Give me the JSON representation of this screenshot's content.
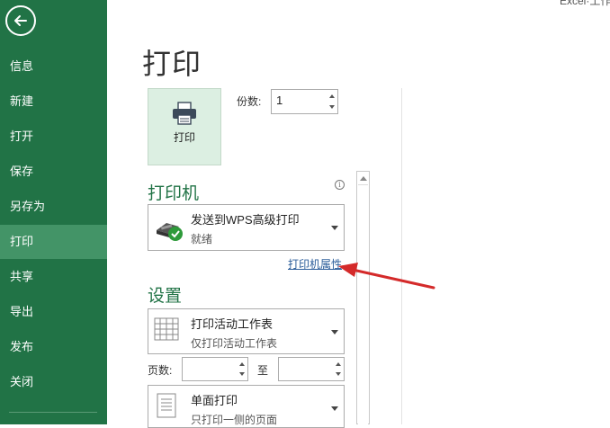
{
  "window": {
    "title": "Excel·工作簿"
  },
  "sidebar": {
    "items": [
      {
        "label": "信息"
      },
      {
        "label": "新建"
      },
      {
        "label": "打开"
      },
      {
        "label": "保存"
      },
      {
        "label": "另存为"
      },
      {
        "label": "打印"
      },
      {
        "label": "共享"
      },
      {
        "label": "导出"
      },
      {
        "label": "发布"
      },
      {
        "label": "关闭"
      }
    ],
    "active": "打印"
  },
  "page": {
    "title": "打印"
  },
  "print_button": {
    "label": "打印"
  },
  "copies": {
    "label": "份数:",
    "value": "1"
  },
  "printer": {
    "heading": "打印机",
    "name": "发送到WPS高级打印",
    "status": "就绪",
    "properties_link": "打印机属性"
  },
  "settings": {
    "heading": "设置",
    "scope": {
      "title": "打印活动工作表",
      "subtitle": "仅打印活动工作表"
    },
    "pages_label": "页数:",
    "to_label": "至",
    "pages_from": "",
    "pages_to": "",
    "sides": {
      "title": "单面打印",
      "subtitle": "只打印一侧的页面"
    }
  },
  "colors": {
    "accent": "#217346",
    "active_nav": "#439467",
    "link": "#2b5d9a",
    "annotation_arrow": "#d42a2a"
  }
}
